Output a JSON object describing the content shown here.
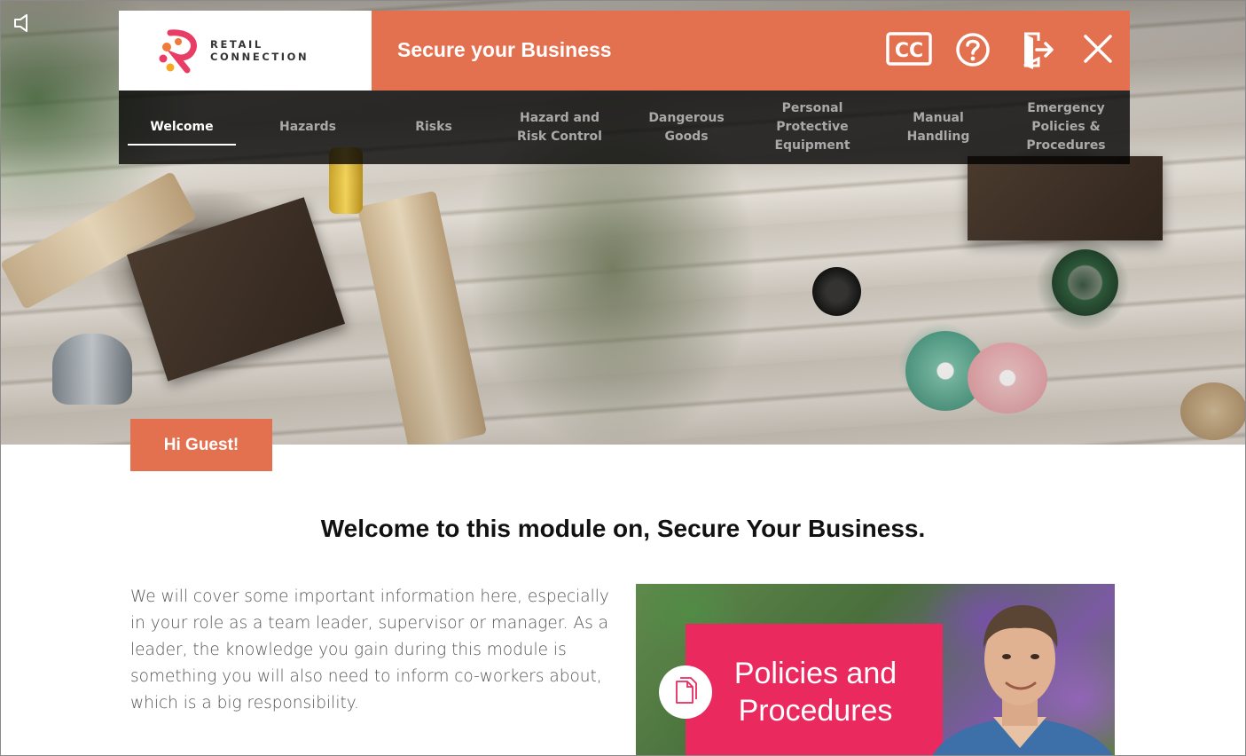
{
  "header": {
    "logo": {
      "line1": "RETAIL",
      "line2": "CONNECTION",
      "colors": [
        "#e83e66",
        "#f07a3a",
        "#f5a623"
      ]
    },
    "title": "Secure your Business",
    "accent_color": "#e3704f",
    "controls": [
      {
        "name": "cc-icon",
        "label": "CC"
      },
      {
        "name": "help-icon"
      },
      {
        "name": "exit-icon"
      },
      {
        "name": "close-icon"
      }
    ]
  },
  "nav": {
    "tabs": [
      {
        "label": "Welcome",
        "active": true
      },
      {
        "label": "Hazards",
        "active": false
      },
      {
        "label": "Risks",
        "active": false
      },
      {
        "label": "Hazard and\nRisk Control",
        "active": false
      },
      {
        "label": "Dangerous\nGoods",
        "active": false
      },
      {
        "label": "Personal\nProtective\nEquipment",
        "active": false
      },
      {
        "label": "Manual\nHandling",
        "active": false
      },
      {
        "label": "Emergency\nPolicies &\nProcedures",
        "active": false
      }
    ]
  },
  "greeting": "Hi Guest!",
  "main": {
    "heading": "Welcome to this module on, Secure Your Business.",
    "body": "We will cover some important information here, especially in your role as a team leader, supervisor or manager. As a leader, the knowledge you gain during this module is something you will also need to inform co-workers about, which is a big responsibility."
  },
  "card": {
    "title": "Policies and Procedures",
    "color": "#ea2a5e"
  }
}
